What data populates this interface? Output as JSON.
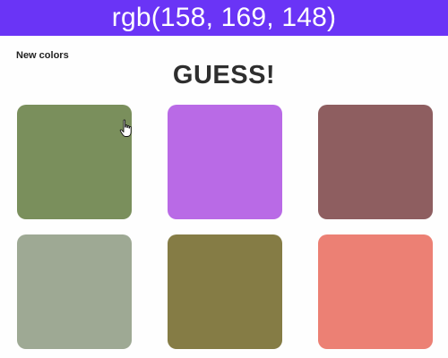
{
  "header": {
    "target_color": "rgb(158, 169, 148)",
    "background": "#6a34f6"
  },
  "controls": {
    "new_colors_label": "New colors"
  },
  "message": "GUESS!",
  "swatches": [
    {
      "color": "#7a8f5c"
    },
    {
      "color": "#b96ae6"
    },
    {
      "color": "#8e5e60"
    },
    {
      "color": "#9ea994"
    },
    {
      "color": "#857c45"
    },
    {
      "color": "#ec8074"
    }
  ],
  "cursor": {
    "icon": "hand-pointer-icon"
  }
}
